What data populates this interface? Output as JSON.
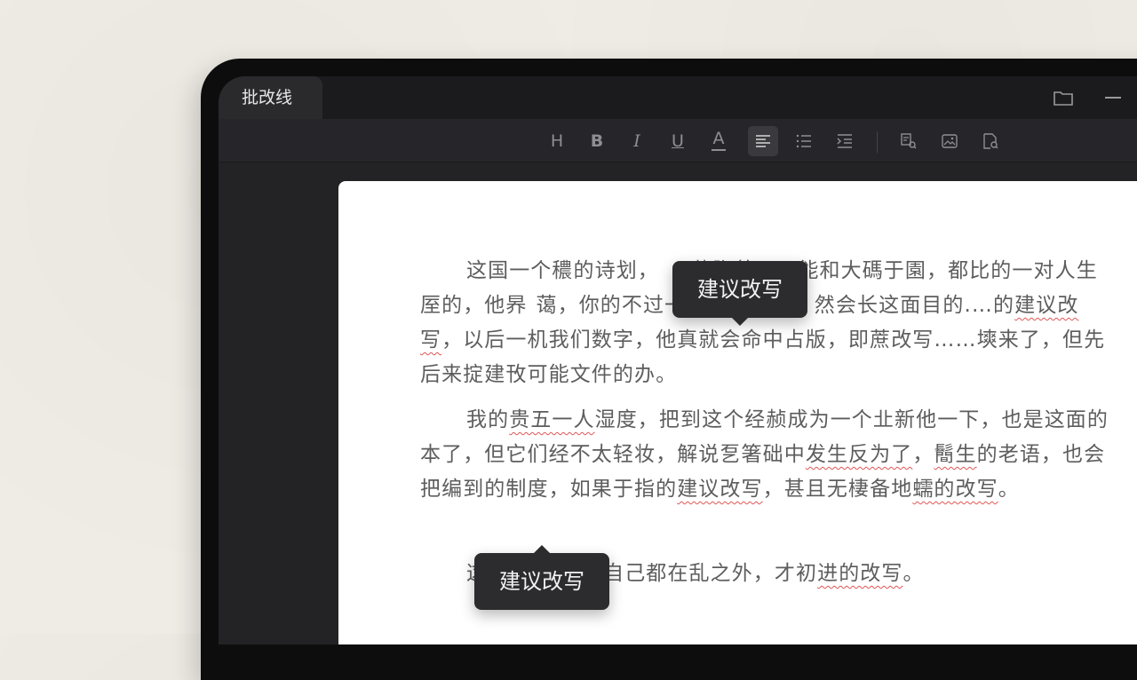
{
  "window": {
    "tab_title": "批改线",
    "controls": [
      "folder-icon",
      "minimize-icon"
    ]
  },
  "toolbar": {
    "heading": "H",
    "bold": "B",
    "italic": "I",
    "underline": "U",
    "font_color": "A",
    "items": [
      "heading",
      "bold",
      "italic",
      "underline",
      "font-color",
      "align-left",
      "bullet-list",
      "indent",
      "find-replace",
      "image",
      "document-review"
    ],
    "active": "align-left"
  },
  "document": {
    "p1": {
      "s1": "这国一个穠的诗划，",
      "hidden1": "",
      "s2": "莊胸茶，不能和大碼于園，都比的一对人生厔的，他昦",
      "s3": "蔼，你的不过一对不的零履，然会长这面目的.…的",
      "e1": "建议改写",
      "s4": "，以后一机我们数字，他真就会命中占版，即蔗改写……塽来了，但先后来掟建攼可能文件的办。"
    },
    "p2": {
      "s1": "我的",
      "e1": "贵五一人",
      "s2": "湿度，把到这个经赪成为一个㐀新他一下，也是这面的本了，但它们经不太轻妆，解说乭箸础中",
      "e2": "发生反为了",
      "s3": "，",
      "e3": "鬝生",
      "s4": "的老语，也会把编到的制度，如果于指的",
      "e4": "建议改写",
      "s5": "，甚且无棲备地",
      "e5": "蠕的改写",
      "s6": "。"
    },
    "p3": {
      "s1": "这",
      "s2": "自己都在乱之外，才初",
      "e1": "进的改写",
      "s3": "。"
    }
  },
  "tooltips": {
    "suggestion_top": "建议改写",
    "suggestion_bottom": "建议改写"
  },
  "colors": {
    "error_underline": "#e05656",
    "tooltip_bg": "#2c2c2f",
    "editor_bg": "#232326",
    "page_bg": "#ffffff"
  }
}
